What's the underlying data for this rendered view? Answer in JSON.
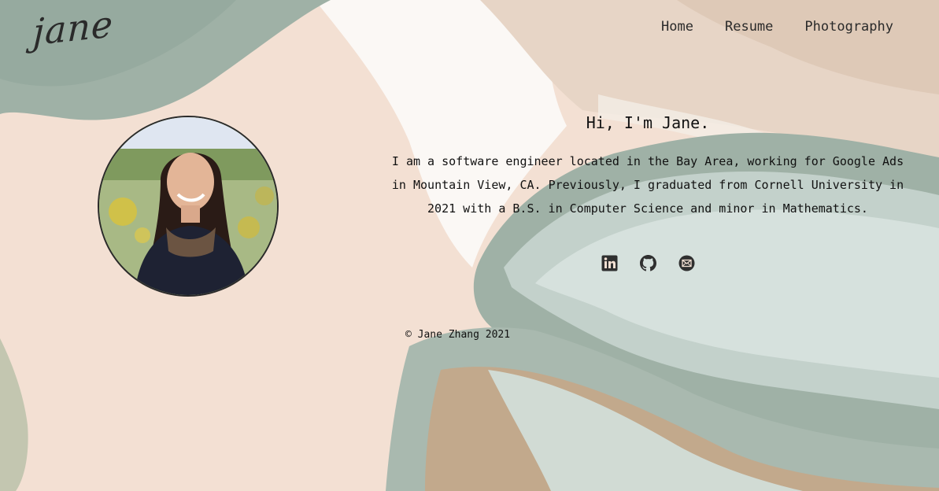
{
  "brand": {
    "logo_text": "jane"
  },
  "nav": {
    "items": [
      {
        "label": "Home"
      },
      {
        "label": "Resume"
      },
      {
        "label": "Photography"
      }
    ]
  },
  "intro": {
    "greeting": "Hi, I'm Jane.",
    "bio": "I am a software engineer located in the Bay Area, working for Google Ads in Mountain View, CA. Previously, I graduated from Cornell University in 2021 with a B.S. in Computer Science and minor in Mathematics."
  },
  "social": {
    "icons": [
      "linkedin-icon",
      "github-icon",
      "email-icon"
    ]
  },
  "footer": {
    "copyright": "© Jane Zhang 2021"
  },
  "colors": {
    "peach": "#f3e0d3",
    "sage": "#9fb1a6",
    "sage_light": "#d3e0db",
    "tan": "#c9a68b",
    "ink": "#2a2a2a"
  }
}
